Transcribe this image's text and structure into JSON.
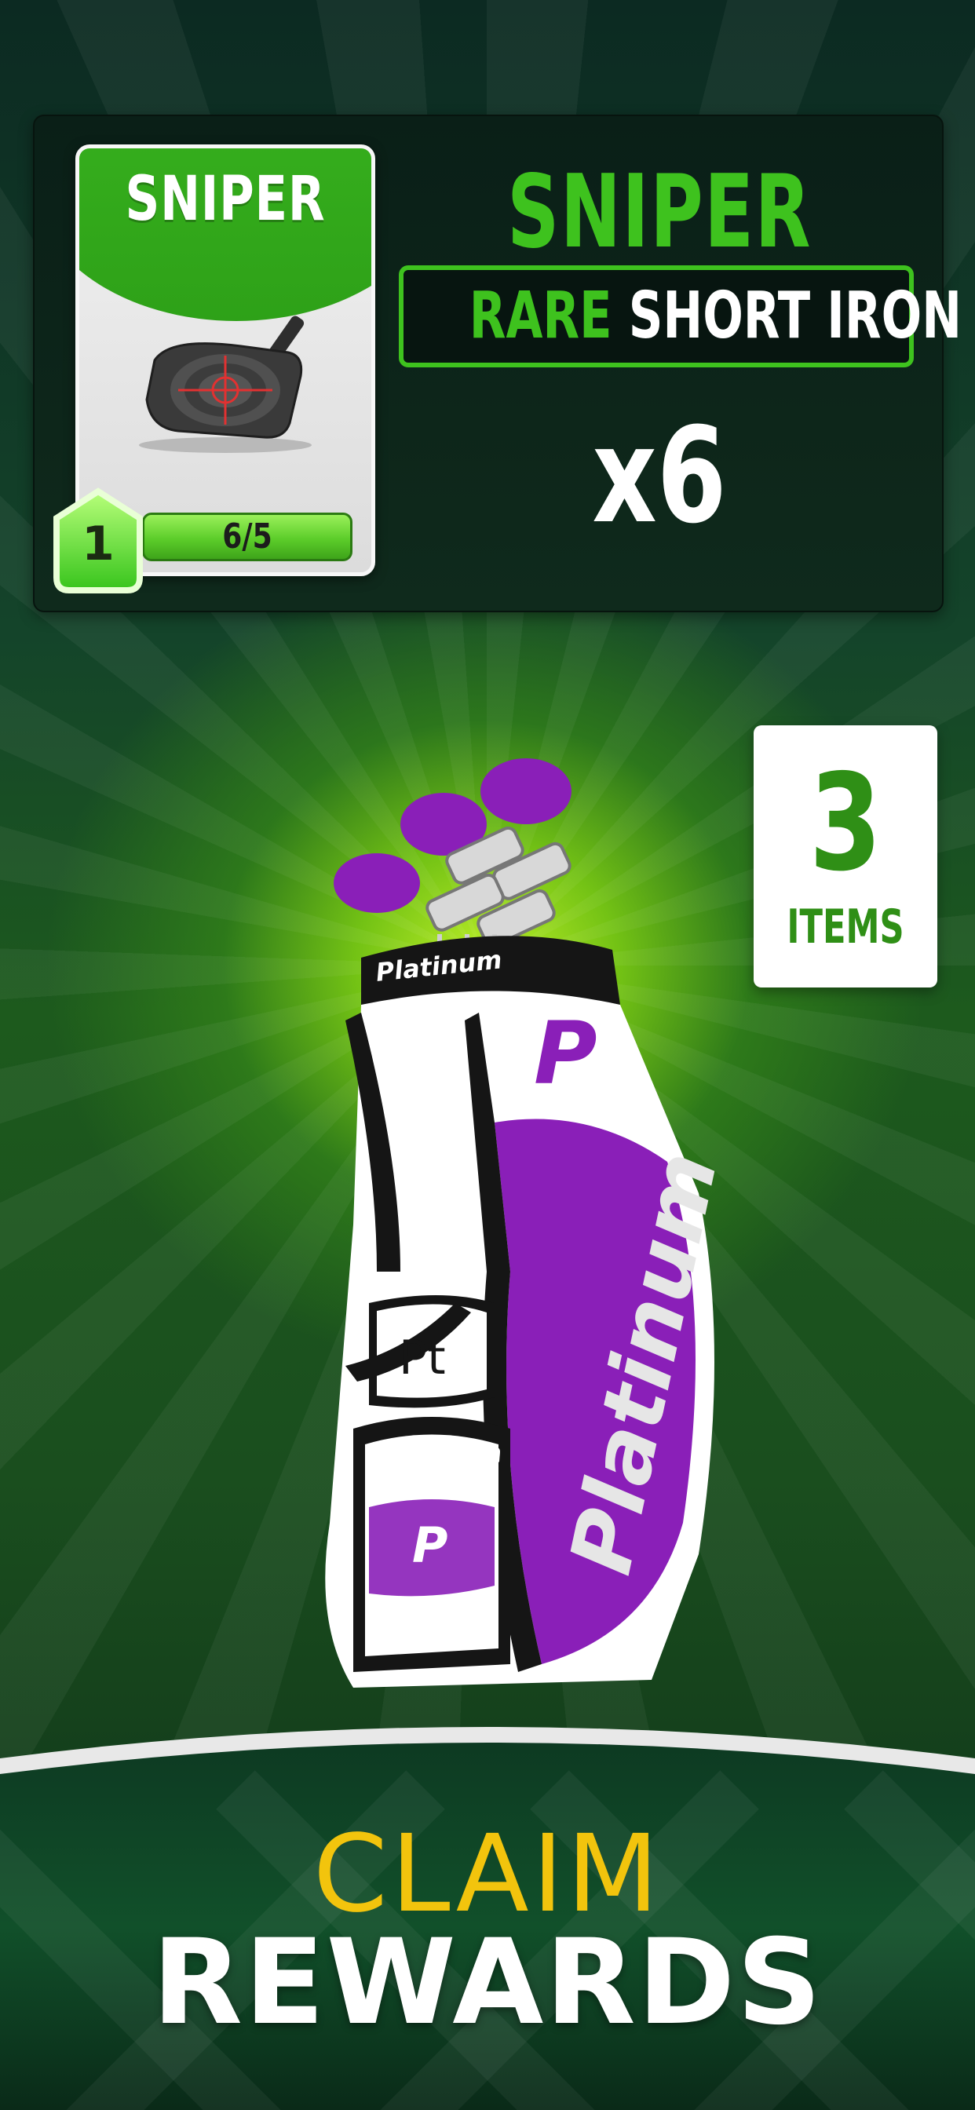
{
  "card": {
    "title": "SNIPER",
    "progress": "6/5",
    "level": "1",
    "club_icon": "iron-club-icon"
  },
  "reward": {
    "name": "SNIPER",
    "rarity": "RARE",
    "club_type": "SHORT IRON",
    "quantity": "x6"
  },
  "items": {
    "count": "3",
    "label": "ITEMS"
  },
  "bag": {
    "icon": "golf-bag-icon",
    "brand": "Platinum",
    "patch": "Pt",
    "logo": "P"
  },
  "claim": {
    "line1": "CLAIM",
    "line2": "REWARDS"
  },
  "colors": {
    "accent_green": "#3ec21e",
    "claim_yellow": "#f2c40d",
    "bag_purple": "#8a1fb8"
  }
}
